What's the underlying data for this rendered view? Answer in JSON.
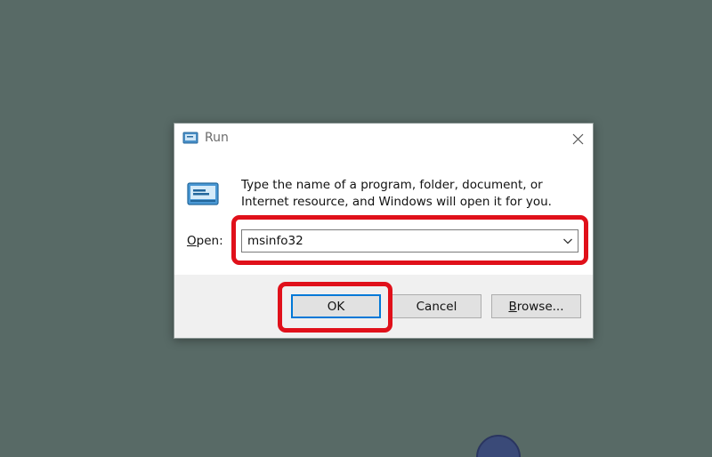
{
  "window": {
    "title": "Run",
    "icon": "run-icon",
    "close_icon": "close-icon"
  },
  "message": "Type the name of a program, folder, document, or Internet resource, and Windows will open it for you.",
  "open_field": {
    "label_accel": "O",
    "label_rest": "pen:",
    "value": "msinfo32",
    "dropdown_icon": "chevron-down-icon"
  },
  "buttons": {
    "ok": "OK",
    "cancel": "Cancel",
    "browse_accel": "B",
    "browse_rest": "rowse..."
  },
  "colors": {
    "desktop": "#586a66",
    "highlight": "#e0101a",
    "focus_border": "#0078d7"
  }
}
